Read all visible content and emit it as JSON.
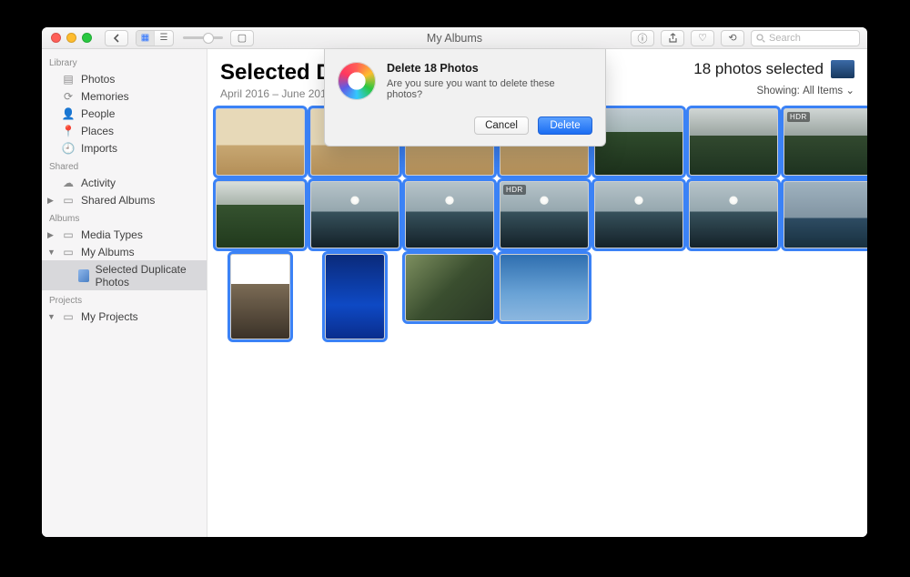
{
  "window": {
    "title": "My Albums"
  },
  "toolbar": {
    "search_placeholder": "Search"
  },
  "sidebar": {
    "sections": {
      "library": {
        "header": "Library",
        "items": [
          "Photos",
          "Memories",
          "People",
          "Places",
          "Imports"
        ]
      },
      "shared": {
        "header": "Shared",
        "items": [
          "Activity",
          "Shared Albums"
        ]
      },
      "albums": {
        "header": "Albums",
        "items": [
          "Media Types",
          "My Albums"
        ],
        "sub": "Selected Duplicate Photos"
      },
      "projects": {
        "header": "Projects",
        "items": [
          "My Projects"
        ]
      }
    }
  },
  "main": {
    "album_title": "Selected Duplicate Photos",
    "date_range": "April 2016 – June 2018",
    "selection_text": "18 photos selected",
    "showing_label": "Showing:",
    "showing_value": "All Items",
    "photos": [
      {
        "cls": "beach",
        "sel": true
      },
      {
        "cls": "beach",
        "sel": true
      },
      {
        "cls": "beach",
        "sel": true
      },
      {
        "cls": "beach",
        "sel": true
      },
      {
        "cls": "trees",
        "sel": true
      },
      {
        "cls": "trees2",
        "sel": true
      },
      {
        "cls": "trees2",
        "sel": true,
        "badge": "HDR"
      },
      {
        "cls": "foliage",
        "sel": true
      },
      {
        "cls": "sunset",
        "sel": true
      },
      {
        "cls": "sunset",
        "sel": true
      },
      {
        "cls": "sunset",
        "sel": true,
        "badge": "HDR"
      },
      {
        "cls": "sunset",
        "sel": true
      },
      {
        "cls": "sunset",
        "sel": true
      },
      {
        "cls": "boat",
        "sel": true
      },
      {
        "cls": "hall",
        "sel": true,
        "portrait": true
      },
      {
        "cls": "aqua",
        "sel": true,
        "portrait": true
      },
      {
        "cls": "pier",
        "sel": true
      },
      {
        "cls": "sky",
        "sel": true
      }
    ]
  },
  "dialog": {
    "title": "Delete 18 Photos",
    "message": "Are you sure you want to delete these photos?",
    "cancel": "Cancel",
    "confirm": "Delete"
  }
}
